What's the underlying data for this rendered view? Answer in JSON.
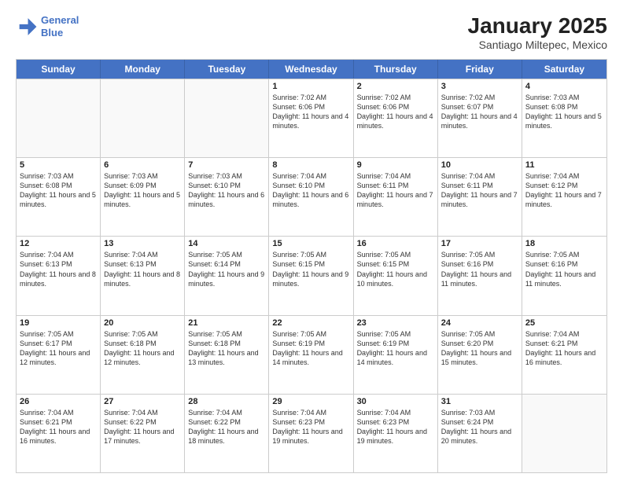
{
  "header": {
    "logo_line1": "General",
    "logo_line2": "Blue",
    "month": "January 2025",
    "location": "Santiago Miltepec, Mexico"
  },
  "weekdays": [
    "Sunday",
    "Monday",
    "Tuesday",
    "Wednesday",
    "Thursday",
    "Friday",
    "Saturday"
  ],
  "rows": [
    [
      {
        "day": "",
        "info": ""
      },
      {
        "day": "",
        "info": ""
      },
      {
        "day": "",
        "info": ""
      },
      {
        "day": "1",
        "info": "Sunrise: 7:02 AM\nSunset: 6:06 PM\nDaylight: 11 hours and 4 minutes."
      },
      {
        "day": "2",
        "info": "Sunrise: 7:02 AM\nSunset: 6:06 PM\nDaylight: 11 hours and 4 minutes."
      },
      {
        "day": "3",
        "info": "Sunrise: 7:02 AM\nSunset: 6:07 PM\nDaylight: 11 hours and 4 minutes."
      },
      {
        "day": "4",
        "info": "Sunrise: 7:03 AM\nSunset: 6:08 PM\nDaylight: 11 hours and 5 minutes."
      }
    ],
    [
      {
        "day": "5",
        "info": "Sunrise: 7:03 AM\nSunset: 6:08 PM\nDaylight: 11 hours and 5 minutes."
      },
      {
        "day": "6",
        "info": "Sunrise: 7:03 AM\nSunset: 6:09 PM\nDaylight: 11 hours and 5 minutes."
      },
      {
        "day": "7",
        "info": "Sunrise: 7:03 AM\nSunset: 6:10 PM\nDaylight: 11 hours and 6 minutes."
      },
      {
        "day": "8",
        "info": "Sunrise: 7:04 AM\nSunset: 6:10 PM\nDaylight: 11 hours and 6 minutes."
      },
      {
        "day": "9",
        "info": "Sunrise: 7:04 AM\nSunset: 6:11 PM\nDaylight: 11 hours and 7 minutes."
      },
      {
        "day": "10",
        "info": "Sunrise: 7:04 AM\nSunset: 6:11 PM\nDaylight: 11 hours and 7 minutes."
      },
      {
        "day": "11",
        "info": "Sunrise: 7:04 AM\nSunset: 6:12 PM\nDaylight: 11 hours and 7 minutes."
      }
    ],
    [
      {
        "day": "12",
        "info": "Sunrise: 7:04 AM\nSunset: 6:13 PM\nDaylight: 11 hours and 8 minutes."
      },
      {
        "day": "13",
        "info": "Sunrise: 7:04 AM\nSunset: 6:13 PM\nDaylight: 11 hours and 8 minutes."
      },
      {
        "day": "14",
        "info": "Sunrise: 7:05 AM\nSunset: 6:14 PM\nDaylight: 11 hours and 9 minutes."
      },
      {
        "day": "15",
        "info": "Sunrise: 7:05 AM\nSunset: 6:15 PM\nDaylight: 11 hours and 9 minutes."
      },
      {
        "day": "16",
        "info": "Sunrise: 7:05 AM\nSunset: 6:15 PM\nDaylight: 11 hours and 10 minutes."
      },
      {
        "day": "17",
        "info": "Sunrise: 7:05 AM\nSunset: 6:16 PM\nDaylight: 11 hours and 11 minutes."
      },
      {
        "day": "18",
        "info": "Sunrise: 7:05 AM\nSunset: 6:16 PM\nDaylight: 11 hours and 11 minutes."
      }
    ],
    [
      {
        "day": "19",
        "info": "Sunrise: 7:05 AM\nSunset: 6:17 PM\nDaylight: 11 hours and 12 minutes."
      },
      {
        "day": "20",
        "info": "Sunrise: 7:05 AM\nSunset: 6:18 PM\nDaylight: 11 hours and 12 minutes."
      },
      {
        "day": "21",
        "info": "Sunrise: 7:05 AM\nSunset: 6:18 PM\nDaylight: 11 hours and 13 minutes."
      },
      {
        "day": "22",
        "info": "Sunrise: 7:05 AM\nSunset: 6:19 PM\nDaylight: 11 hours and 14 minutes."
      },
      {
        "day": "23",
        "info": "Sunrise: 7:05 AM\nSunset: 6:19 PM\nDaylight: 11 hours and 14 minutes."
      },
      {
        "day": "24",
        "info": "Sunrise: 7:05 AM\nSunset: 6:20 PM\nDaylight: 11 hours and 15 minutes."
      },
      {
        "day": "25",
        "info": "Sunrise: 7:04 AM\nSunset: 6:21 PM\nDaylight: 11 hours and 16 minutes."
      }
    ],
    [
      {
        "day": "26",
        "info": "Sunrise: 7:04 AM\nSunset: 6:21 PM\nDaylight: 11 hours and 16 minutes."
      },
      {
        "day": "27",
        "info": "Sunrise: 7:04 AM\nSunset: 6:22 PM\nDaylight: 11 hours and 17 minutes."
      },
      {
        "day": "28",
        "info": "Sunrise: 7:04 AM\nSunset: 6:22 PM\nDaylight: 11 hours and 18 minutes."
      },
      {
        "day": "29",
        "info": "Sunrise: 7:04 AM\nSunset: 6:23 PM\nDaylight: 11 hours and 19 minutes."
      },
      {
        "day": "30",
        "info": "Sunrise: 7:04 AM\nSunset: 6:23 PM\nDaylight: 11 hours and 19 minutes."
      },
      {
        "day": "31",
        "info": "Sunrise: 7:03 AM\nSunset: 6:24 PM\nDaylight: 11 hours and 20 minutes."
      },
      {
        "day": "",
        "info": ""
      }
    ]
  ]
}
